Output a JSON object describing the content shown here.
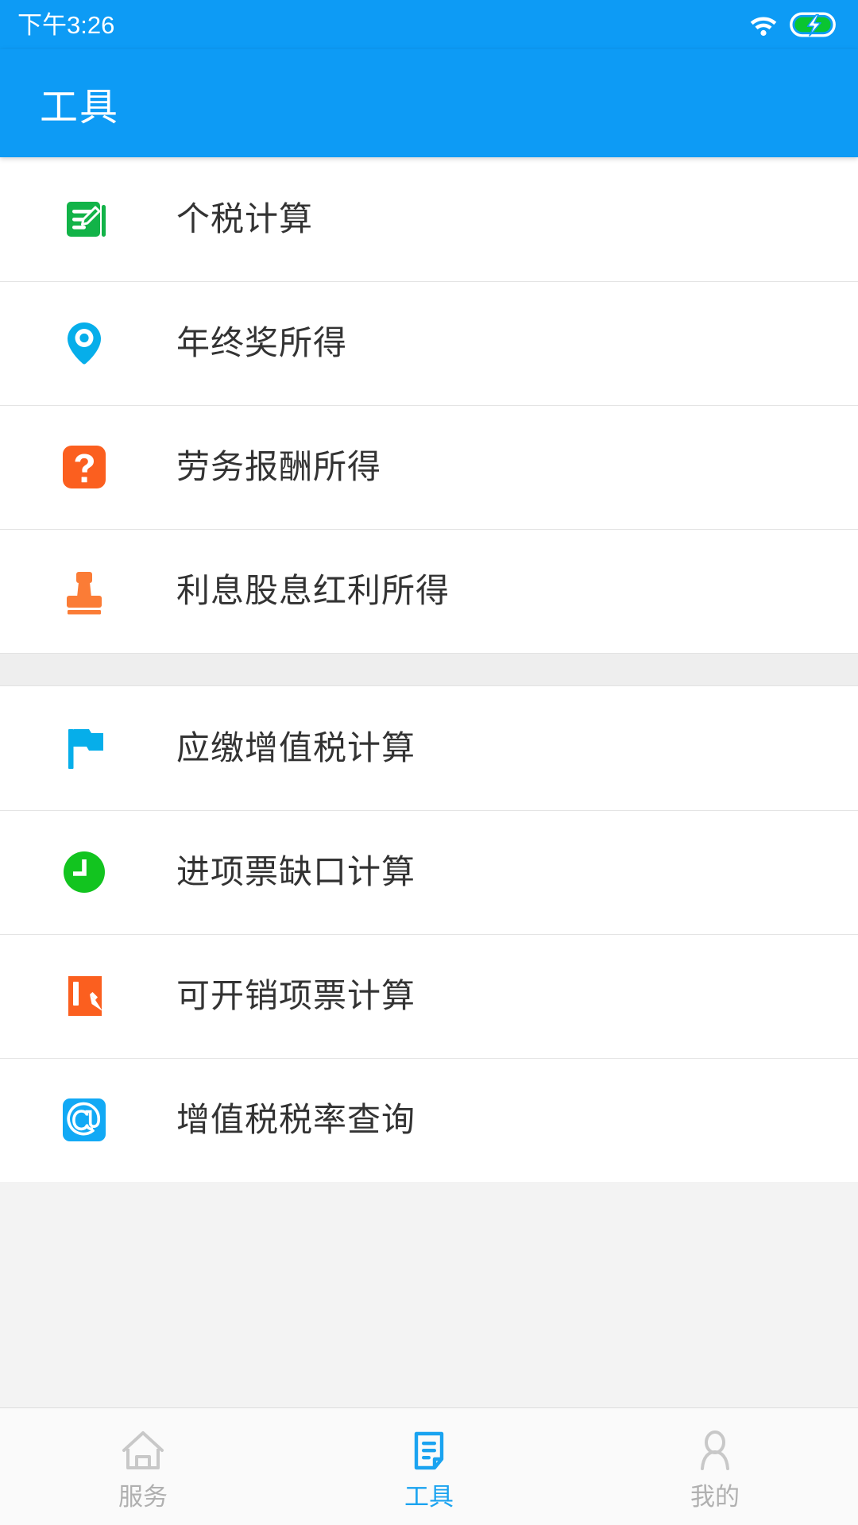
{
  "status_bar": {
    "time": "下午3:26",
    "wifi_icon": "wifi-icon",
    "battery_icon": "battery-charging-icon",
    "background_color": "#0d9bf5"
  },
  "app_bar": {
    "title": "工具",
    "background_color": "#0d9bf5",
    "title_color": "#ffffff"
  },
  "groups": [
    {
      "items": [
        {
          "label": "个税计算",
          "icon": "note-edit-icon",
          "icon_color": "#12b348"
        },
        {
          "label": "年终奖所得",
          "icon": "location-pin-icon",
          "icon_color": "#06aeea"
        },
        {
          "label": "劳务报酬所得",
          "icon": "question-mark-icon",
          "icon_color": "#fb5f1f"
        },
        {
          "label": "利息股息红利所得",
          "icon": "stamp-icon",
          "icon_color": "#fb7c36"
        }
      ]
    },
    {
      "items": [
        {
          "label": "应缴增值税计算",
          "icon": "flag-icon",
          "icon_color": "#06aeea"
        },
        {
          "label": "进项票缺口计算",
          "icon": "clock-icon",
          "icon_color": "#12c41f"
        },
        {
          "label": "可开销项票计算",
          "icon": "document-pencil-icon",
          "icon_color": "#fb5f1f"
        },
        {
          "label": "增值税税率查询",
          "icon": "at-sign-icon",
          "icon_color": "#12a9f5"
        }
      ]
    }
  ],
  "tab_bar": {
    "active_color": "#1aa3f0",
    "inactive_color": "#b0b0b0",
    "tabs": [
      {
        "label": "服务",
        "icon": "home-icon",
        "active": false
      },
      {
        "label": "工具",
        "icon": "tools-note-icon",
        "active": true
      },
      {
        "label": "我的",
        "icon": "person-icon",
        "active": false
      }
    ]
  }
}
